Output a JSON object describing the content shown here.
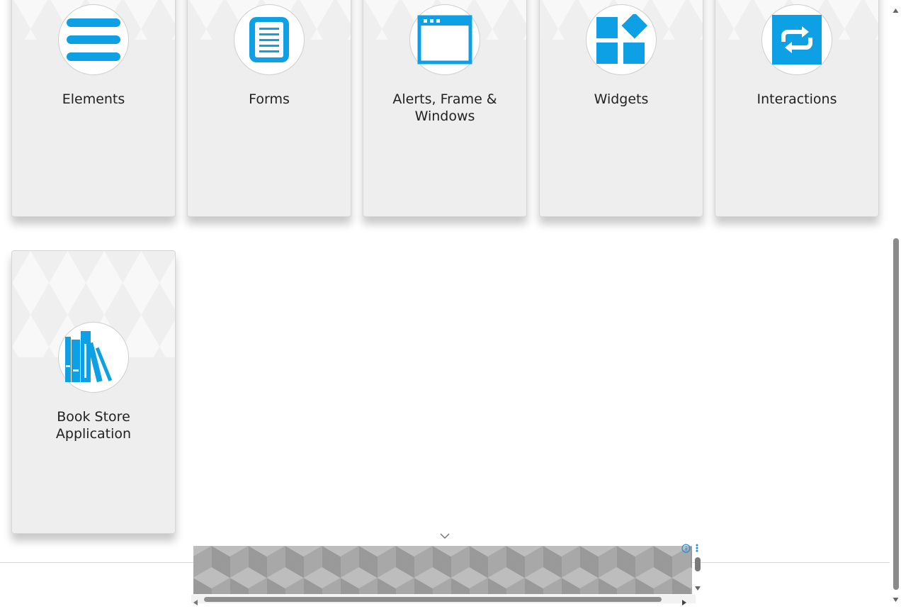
{
  "cards": [
    {
      "title": "Elements",
      "icon": "list-lines-icon"
    },
    {
      "title": "Forms",
      "icon": "form-document-icon"
    },
    {
      "title": "Alerts, Frame & Windows",
      "icon": "browser-window-icon"
    },
    {
      "title": "Widgets",
      "icon": "widget-blocks-icon"
    },
    {
      "title": "Interactions",
      "icon": "swap-arrows-icon"
    },
    {
      "title": "Book Store Application",
      "icon": "books-icon"
    }
  ],
  "colors": {
    "accent": "#0ea0e4",
    "card_background": "#eeeeee",
    "title_text": "#212121"
  },
  "ad": {
    "info_icon": "info-icon",
    "menu_icon": "vertical-dots-icon",
    "toggle_icon": "chevron-down-icon"
  }
}
